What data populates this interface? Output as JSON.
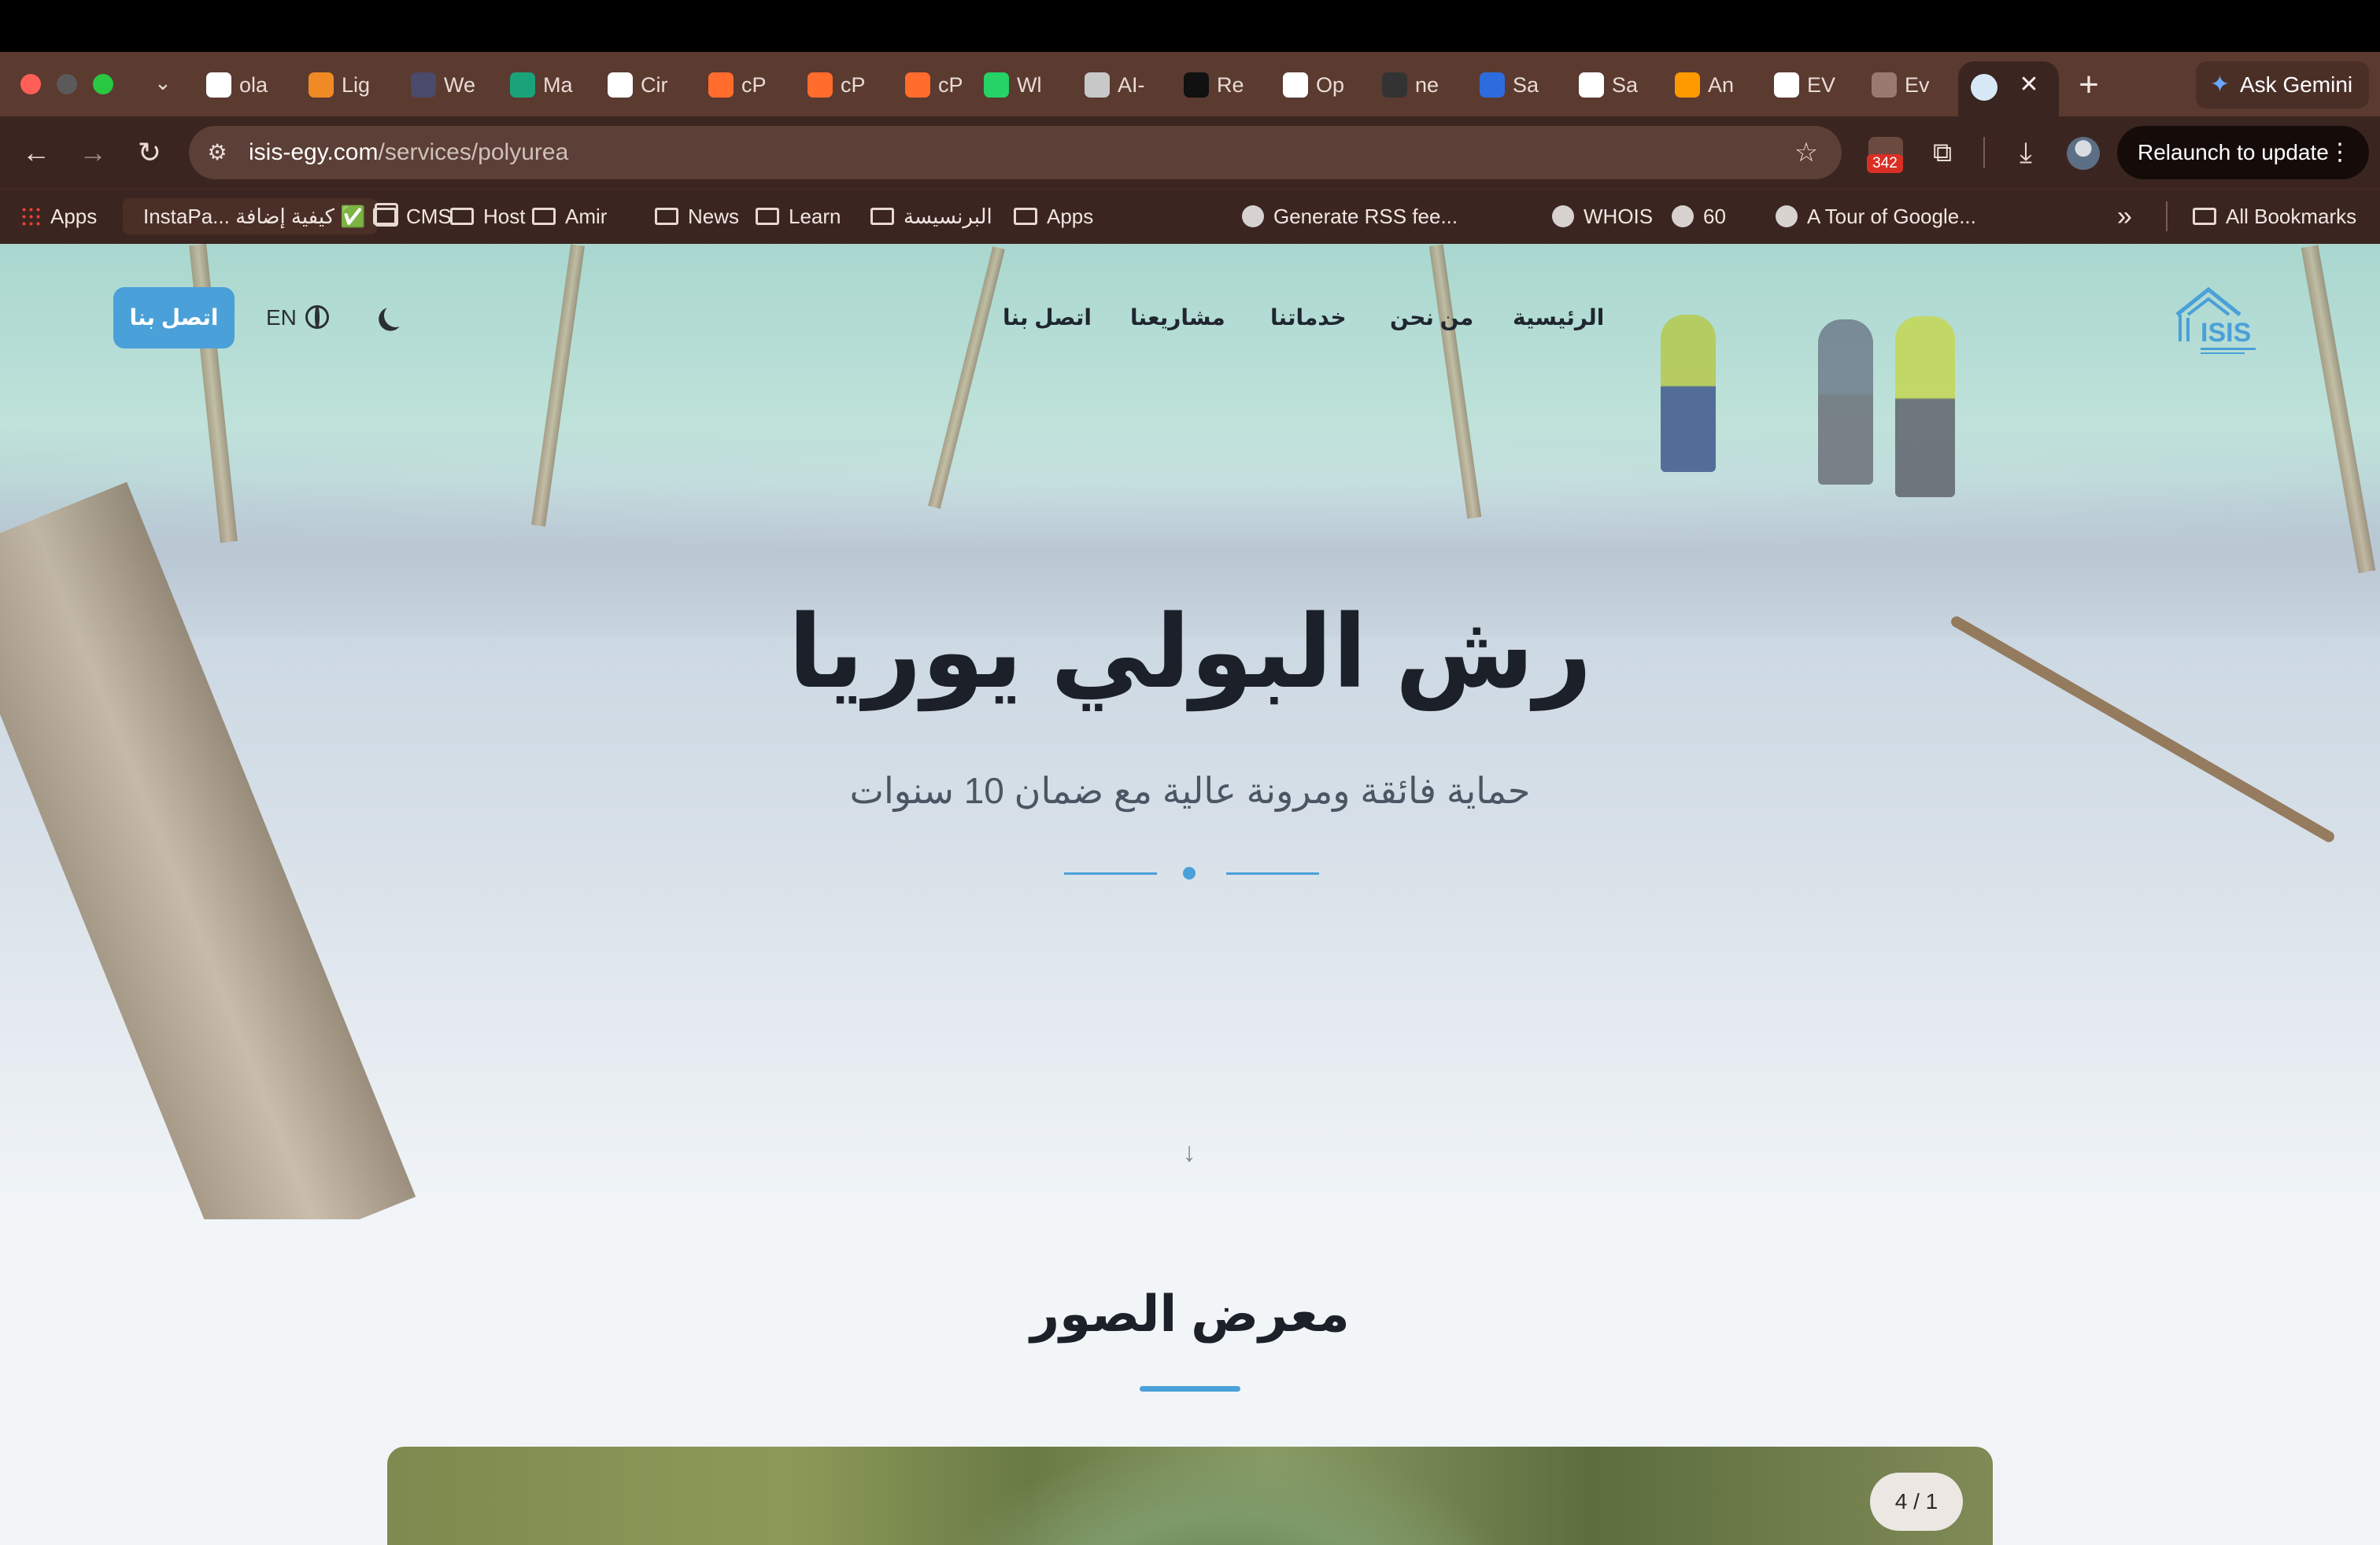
{
  "browser": {
    "tabs": [
      {
        "label": "ola",
        "icon": "github-icon",
        "color": "#ffffff"
      },
      {
        "label": "Lig",
        "icon": "lighthouse-icon",
        "color": "#f08a24"
      },
      {
        "label": "We",
        "icon": "wordpress-icon",
        "color": "#4a4a6a"
      },
      {
        "label": "Ma",
        "icon": "h-icon",
        "color": "#1aa37a"
      },
      {
        "label": "Cir",
        "icon": "circle-check-icon",
        "color": "#ffffff"
      },
      {
        "label": "cP",
        "icon": "cpanel-icon",
        "color": "#ff6c2c"
      },
      {
        "label": "cP",
        "icon": "cpanel-icon",
        "color": "#ff6c2c"
      },
      {
        "label": "cP",
        "icon": "cpanel-icon",
        "color": "#ff6c2c"
      },
      {
        "label": "Wl",
        "icon": "whatsapp-icon",
        "color": "#25d366"
      },
      {
        "label": "AI-",
        "icon": "ai-icon",
        "color": "#c8c8c8"
      },
      {
        "label": "Re",
        "icon": "re-icon",
        "color": "#111111"
      },
      {
        "label": "Op",
        "icon": "openai-icon",
        "color": "#ffffff"
      },
      {
        "label": "ne",
        "icon": "github-icon",
        "color": "#333333"
      },
      {
        "label": "Sa",
        "icon": "sa-icon",
        "color": "#2d6cdf"
      },
      {
        "label": "Sa",
        "icon": "sa-circle-icon",
        "color": "#ffffff"
      },
      {
        "label": "An",
        "icon": "amazon-icon",
        "color": "#ff9900"
      },
      {
        "label": "EV",
        "icon": "circle-check-icon",
        "color": "#ffffff"
      },
      {
        "label": "Ev",
        "icon": "ev-icon",
        "color": "#9a7a70"
      }
    ],
    "new_tab": "+",
    "ask_gemini": "Ask Gemini",
    "url_host": "isis-egy.com",
    "url_path": "/services/polyurea",
    "extension_badge": "342",
    "relaunch": "Relaunch to update",
    "bookmarks": [
      {
        "label": "Apps",
        "type": "apps"
      },
      {
        "label": "InstaPa... كيفية إضافة ✅",
        "type": "chip"
      },
      {
        "label": "CMS",
        "type": "folder"
      },
      {
        "label": "Host",
        "type": "folder"
      },
      {
        "label": "Amir",
        "type": "folder"
      },
      {
        "label": "News",
        "type": "folder"
      },
      {
        "label": "Learn",
        "type": "folder"
      },
      {
        "label": "البرنسيسة",
        "type": "folder"
      },
      {
        "label": "Apps",
        "type": "folder"
      },
      {
        "label": "Generate RSS fee...",
        "type": "link"
      },
      {
        "label": "WHOIS",
        "type": "link"
      },
      {
        "label": "60",
        "type": "link"
      },
      {
        "label": "A Tour of Google...",
        "type": "link"
      }
    ],
    "bookmarks_overflow": "»",
    "all_bookmarks": "All Bookmarks"
  },
  "site": {
    "nav": {
      "contact_button": "اتصل بنا",
      "lang": "EN",
      "items": [
        "الرئيسية",
        "من نحن",
        "خدماتنا",
        "مشاريعنا",
        "اتصل بنا"
      ]
    },
    "logo_text": "ISIS",
    "hero": {
      "title": "رش البولي يوريا",
      "subtitle": "حماية فائقة ومرونة عالية مع ضمان 10 سنوات",
      "scroll_arrow": "↓"
    },
    "gallery": {
      "title": "معرض الصور",
      "counter": "4 / 1"
    },
    "accent": "#4aa0d8"
  }
}
